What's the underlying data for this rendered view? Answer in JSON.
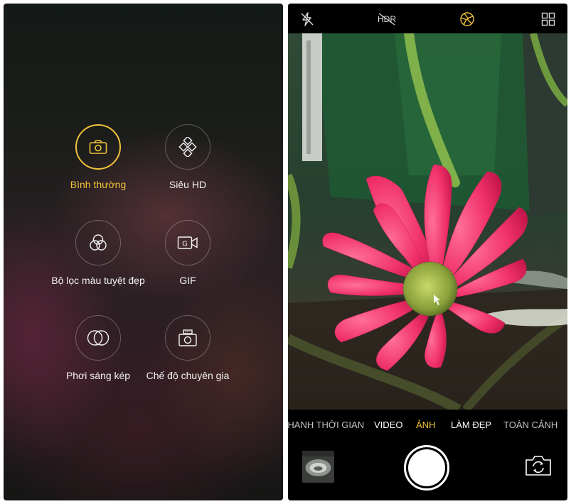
{
  "left_panel": {
    "modes": [
      {
        "label": "Bình thường",
        "icon": "camera-icon",
        "active": true
      },
      {
        "label": "Siêu HD",
        "icon": "diamond-grid-icon",
        "active": false
      },
      {
        "label": "Bộ lọc màu tuyệt đẹp",
        "icon": "color-filter-icon",
        "active": false
      },
      {
        "label": "GIF",
        "icon": "gif-camera-icon",
        "active": false
      },
      {
        "label": "Phơi sáng kép",
        "icon": "double-exposure-icon",
        "active": false
      },
      {
        "label": "Chế độ chuyên gia",
        "icon": "pro-camera-icon",
        "active": false
      }
    ]
  },
  "camera": {
    "top_bar": {
      "flash": "flash-off-icon",
      "hdr_label": "HDR",
      "aperture": "aperture-icon",
      "grid": "grid-menu-icon"
    },
    "modes": [
      {
        "label": "NHANH THỜI GIAN",
        "active": false
      },
      {
        "label": "VIDEO",
        "active": false
      },
      {
        "label": "ẢNH",
        "active": true
      },
      {
        "label": "LÀM ĐẸP",
        "active": false
      },
      {
        "label": "TOÀN CẢNH",
        "active": false
      }
    ],
    "bottom_bar": {
      "gallery_thumbnail": "gallery-thumbnail",
      "shutter": "shutter-button",
      "switch_camera": "switch-camera-icon"
    }
  },
  "colors": {
    "accent": "#f0c23a",
    "text": "#f2f2f2",
    "bar_background": "#000000"
  }
}
